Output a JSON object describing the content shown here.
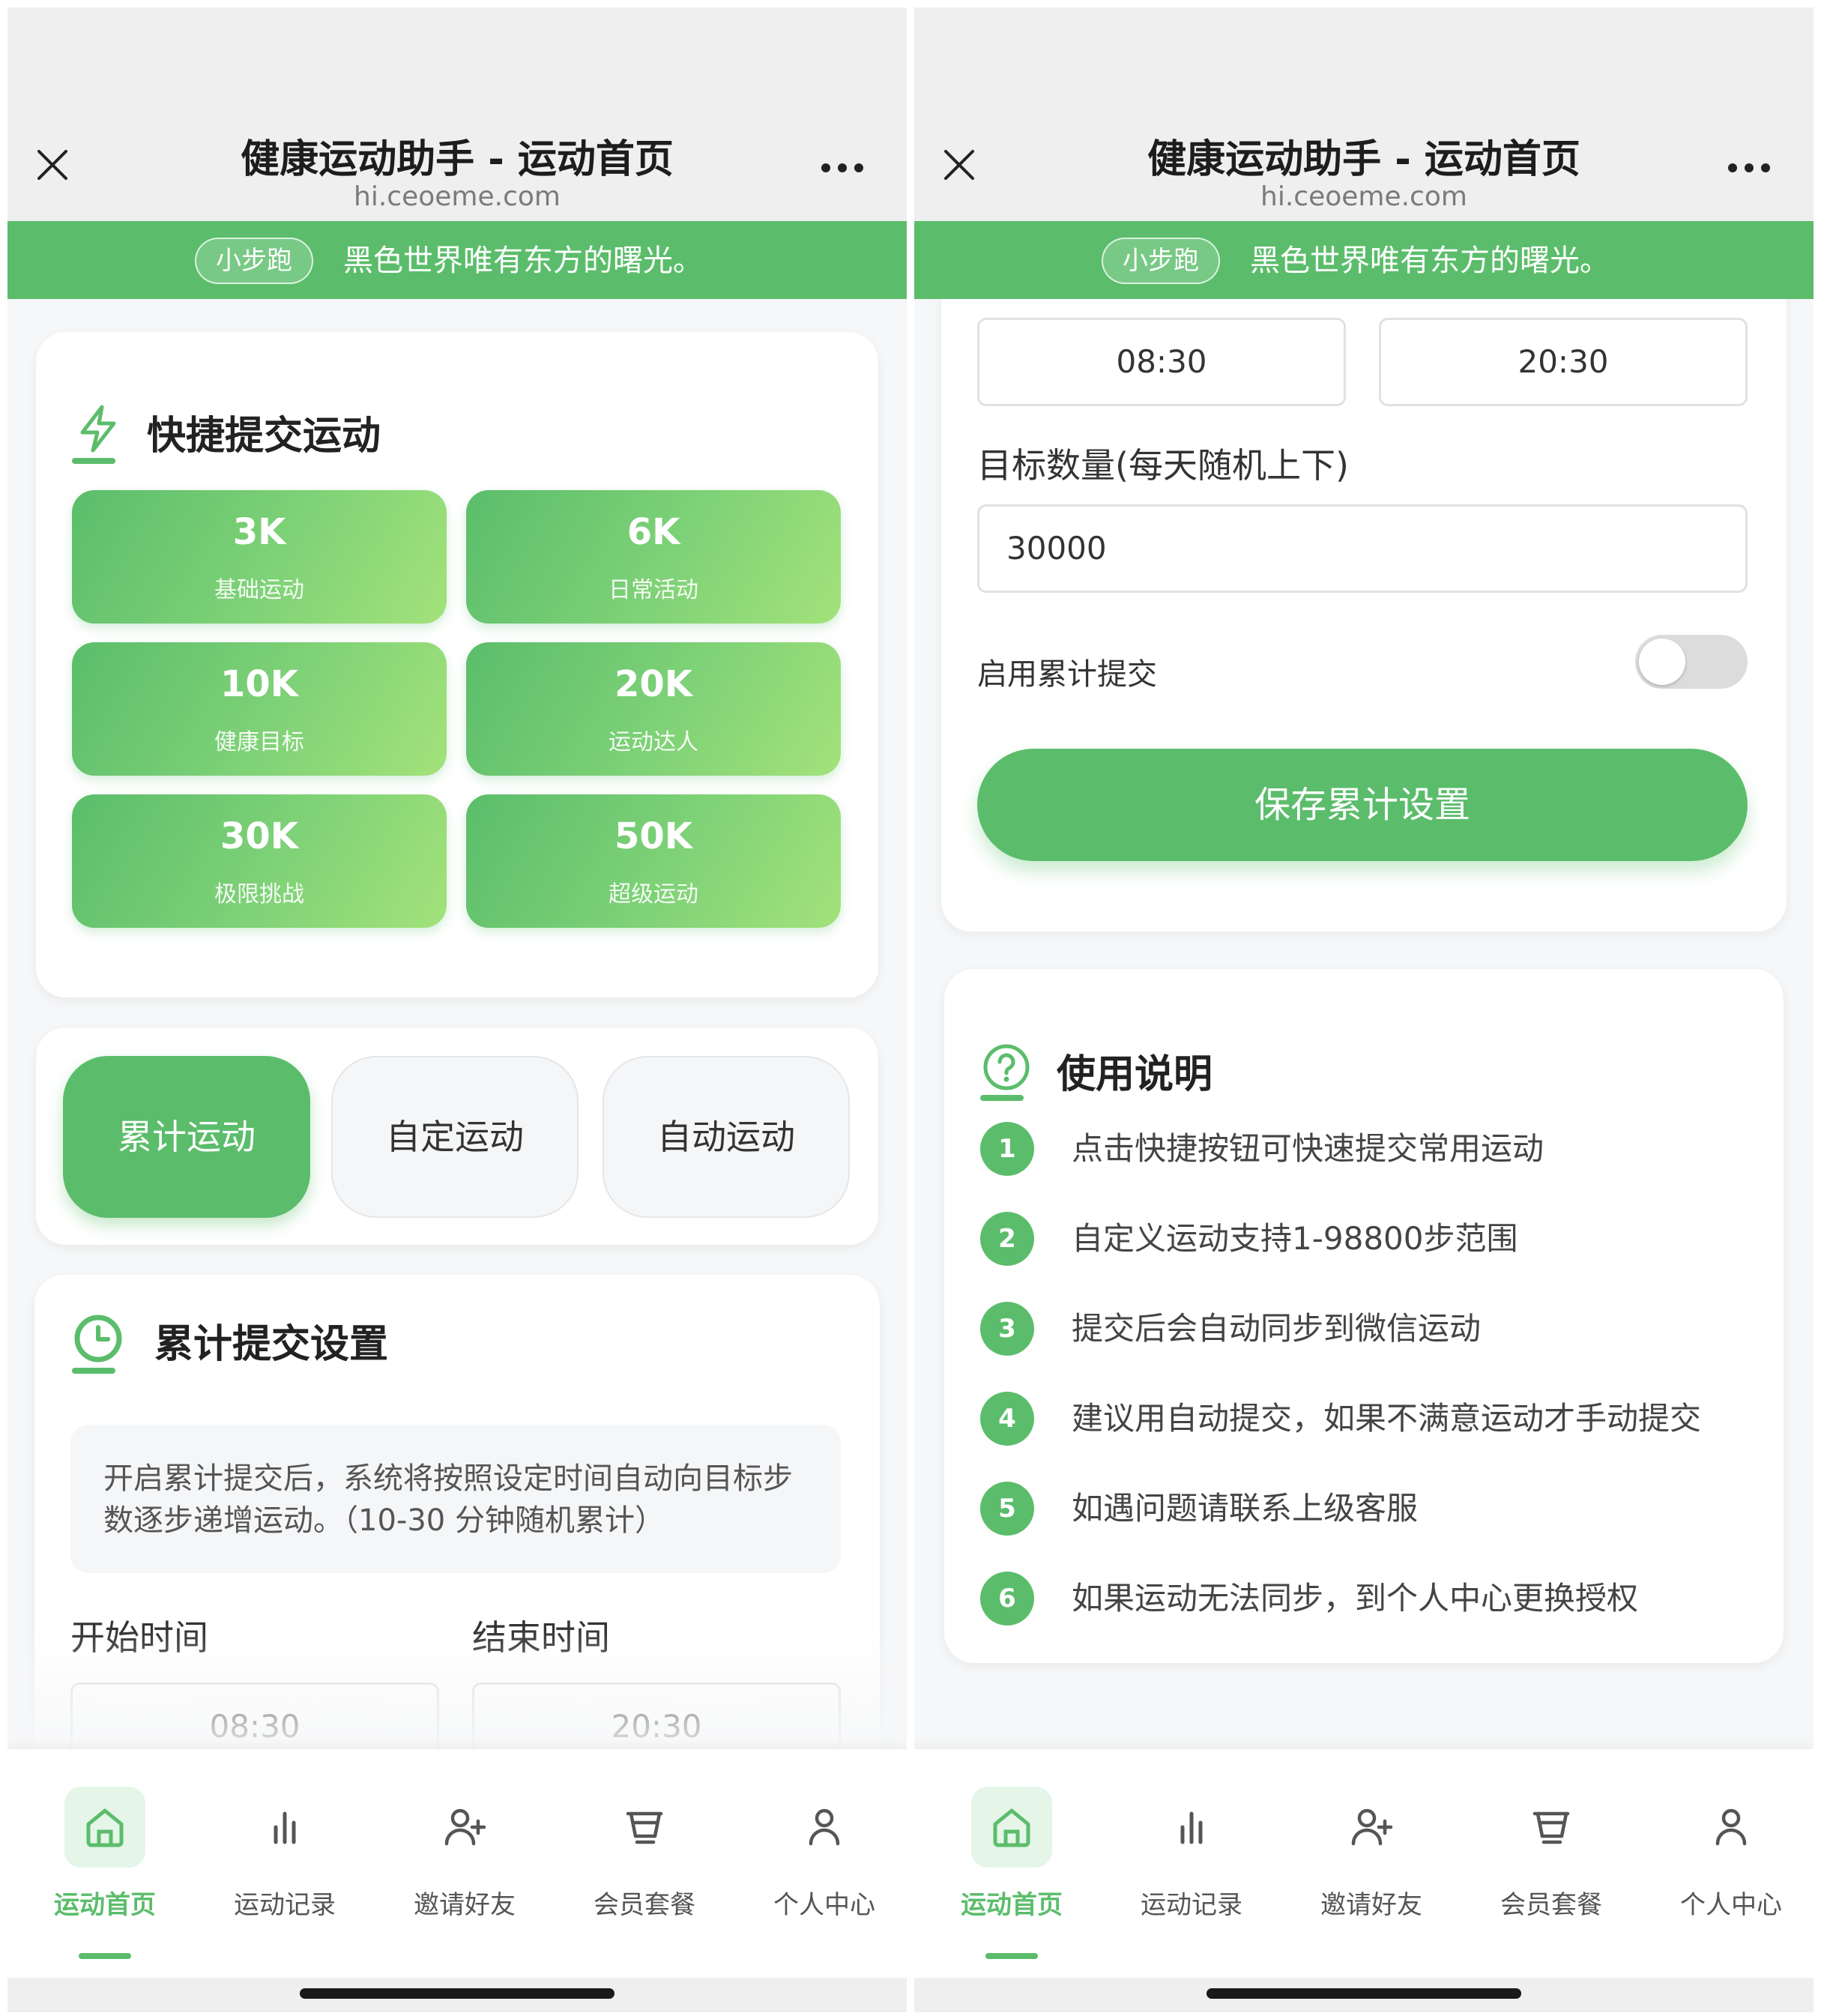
{
  "header": {
    "title": "健康运动助手 - 运动首页",
    "domain": "hi.ceoeme.com"
  },
  "banner": {
    "tag": "小步跑",
    "message": "黑色世界唯有东方的曙光。"
  },
  "quick_submit": {
    "title": "快捷提交运动",
    "buttons": [
      {
        "value": "3K",
        "desc": "基础运动"
      },
      {
        "value": "6K",
        "desc": "日常活动"
      },
      {
        "value": "10K",
        "desc": "健康目标"
      },
      {
        "value": "20K",
        "desc": "运动达人"
      },
      {
        "value": "30K",
        "desc": "极限挑战"
      },
      {
        "value": "50K",
        "desc": "超级运动"
      }
    ]
  },
  "modes": {
    "items": [
      "累计运动",
      "自定运动",
      "自动运动"
    ],
    "active_index": 0
  },
  "cumulative": {
    "title": "累计提交设置",
    "description": "开启累计提交后，系统将按照设定时间自动向目标步数逐步递增运动。（10-30 分钟随机累计）",
    "start_label": "开始时间",
    "end_label": "结束时间",
    "start_time": "08:30",
    "end_time": "20:30",
    "target_label": "目标数量(每天随机上下)",
    "target_value": "30000",
    "enable_label": "启用累计提交",
    "enabled": false,
    "save_label": "保存累计设置"
  },
  "instructions": {
    "title": "使用说明",
    "steps": [
      {
        "num": "1",
        "text": "点击快捷按钮可快速提交常用运动"
      },
      {
        "num": "2",
        "text": "自定义运动支持1-98800步范围"
      },
      {
        "num": "3",
        "text": "提交后会自动同步到微信运动"
      },
      {
        "num": "4",
        "text": "建议用自动提交，如果不满意运动才手动提交"
      },
      {
        "num": "5",
        "text": "如遇问题请联系上级客服"
      },
      {
        "num": "6",
        "text": "如果运动无法同步，到个人中心更换授权"
      }
    ]
  },
  "nav": {
    "items": [
      {
        "label": "运动首页",
        "icon": "home-icon"
      },
      {
        "label": "运动记录",
        "icon": "bar-chart-icon"
      },
      {
        "label": "邀请好友",
        "icon": "add-user-icon"
      },
      {
        "label": "会员套餐",
        "icon": "basket-icon"
      },
      {
        "label": "个人中心",
        "icon": "user-icon"
      }
    ],
    "active_index": 0
  },
  "colors": {
    "accent": "#5bbd6b",
    "accent_light": "#a3e27a",
    "nav_active_bg": "#e5f5e8"
  }
}
